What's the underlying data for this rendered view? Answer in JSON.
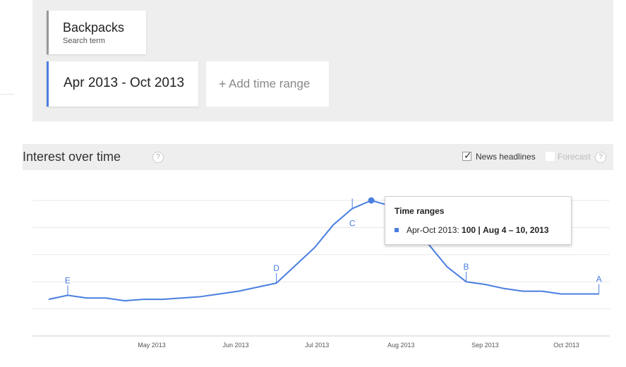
{
  "search_term": {
    "title": "Backpacks",
    "subtitle": "Search term"
  },
  "time_range": {
    "label": "Apr 2013 - Oct 2013"
  },
  "add_time_range": {
    "plus": "+",
    "label": "Add time range"
  },
  "interest_over_time": {
    "title": "Interest over time",
    "help": "?",
    "news_headlines": {
      "label": "News headlines",
      "checked": true
    },
    "forecast": {
      "label": "Forecast",
      "checked": false,
      "help": "?"
    }
  },
  "tooltip": {
    "title": "Time ranges",
    "series": "Apr-Oct 2013",
    "value": "100",
    "separator": "|",
    "week": "Aug 4 – 10, 2013"
  },
  "colors": {
    "accent": "#4a7ee0",
    "grid": "#e8e8e8"
  },
  "chart_data": {
    "type": "line",
    "x_ticks": [
      "May 2013",
      "Jun 2013",
      "Jul 2013",
      "Aug 2013",
      "Sep 2013",
      "Oct 2013"
    ],
    "ylim": [
      0,
      100
    ],
    "grid": true,
    "series": [
      {
        "name": "Apr-Oct 2013",
        "x": [
          "2013-04-07",
          "2013-04-14",
          "2013-04-21",
          "2013-04-28",
          "2013-05-05",
          "2013-05-12",
          "2013-05-19",
          "2013-05-26",
          "2013-06-02",
          "2013-06-09",
          "2013-06-16",
          "2013-06-23",
          "2013-06-30",
          "2013-07-07",
          "2013-07-14",
          "2013-07-21",
          "2013-07-28",
          "2013-08-04",
          "2013-08-11",
          "2013-08-18",
          "2013-08-25",
          "2013-09-01",
          "2013-09-08",
          "2013-09-15",
          "2013-09-22",
          "2013-09-29",
          "2013-10-06",
          "2013-10-13",
          "2013-10-20",
          "2013-10-27"
        ],
        "values": [
          27,
          30,
          28,
          28,
          26,
          27,
          27,
          28,
          29,
          31,
          33,
          36,
          39,
          52,
          65,
          82,
          94,
          100,
          96,
          82,
          68,
          51,
          40,
          38,
          35,
          33,
          33,
          31,
          31,
          31
        ]
      }
    ],
    "annotations": [
      {
        "label": "E",
        "x": "2013-04-14"
      },
      {
        "label": "D",
        "x": "2013-06-30"
      },
      {
        "label": "C",
        "x": "2013-07-28"
      },
      {
        "label": "B",
        "x": "2013-09-08"
      },
      {
        "label": "A",
        "x": "2013-10-27"
      }
    ],
    "highlight": {
      "x": "2013-08-04",
      "value": 100
    }
  }
}
